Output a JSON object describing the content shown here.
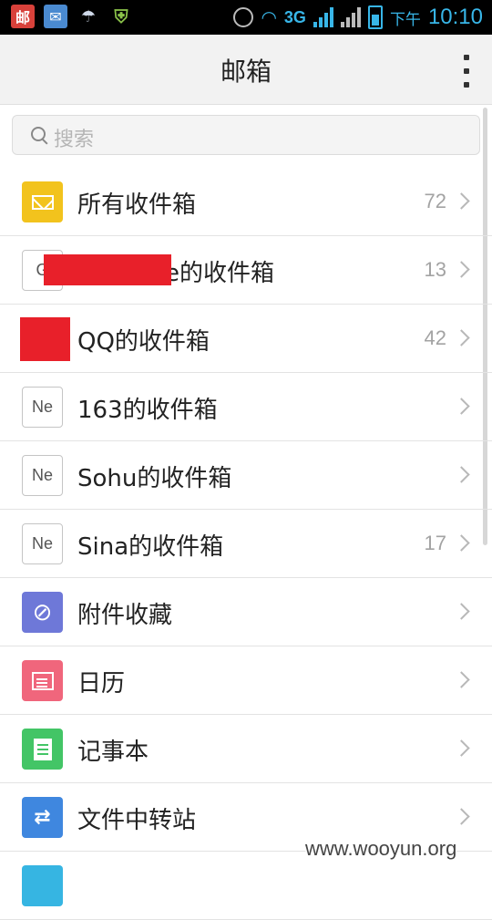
{
  "status_bar": {
    "app_icon_text": "邮",
    "network": "3G",
    "ampm": "下午",
    "time": "10:10"
  },
  "header": {
    "title": "邮箱"
  },
  "search": {
    "placeholder": "搜索"
  },
  "list": [
    {
      "label": "所有收件箱",
      "count": "72",
      "icon": "mail-icon"
    },
    {
      "label": "e的收件箱",
      "count": "13",
      "icon": "letter-icon",
      "icon_text": "G"
    },
    {
      "label": "QQ的收件箱",
      "count": "42",
      "icon": "qq-icon"
    },
    {
      "label": "163的收件箱",
      "count": "",
      "icon": "letter-icon",
      "icon_text": "Ne"
    },
    {
      "label": "Sohu的收件箱",
      "count": "",
      "icon": "letter-icon",
      "icon_text": "Ne"
    },
    {
      "label": "Sina的收件箱",
      "count": "17",
      "icon": "letter-icon",
      "icon_text": "Ne"
    },
    {
      "label": "附件收藏",
      "count": "",
      "icon": "paperclip-icon"
    },
    {
      "label": "日历",
      "count": "",
      "icon": "calendar-icon"
    },
    {
      "label": "记事本",
      "count": "",
      "icon": "notepad-icon"
    },
    {
      "label": "文件中转站",
      "count": "",
      "icon": "transfer-icon"
    }
  ],
  "watermark": "www.wooyun.org"
}
